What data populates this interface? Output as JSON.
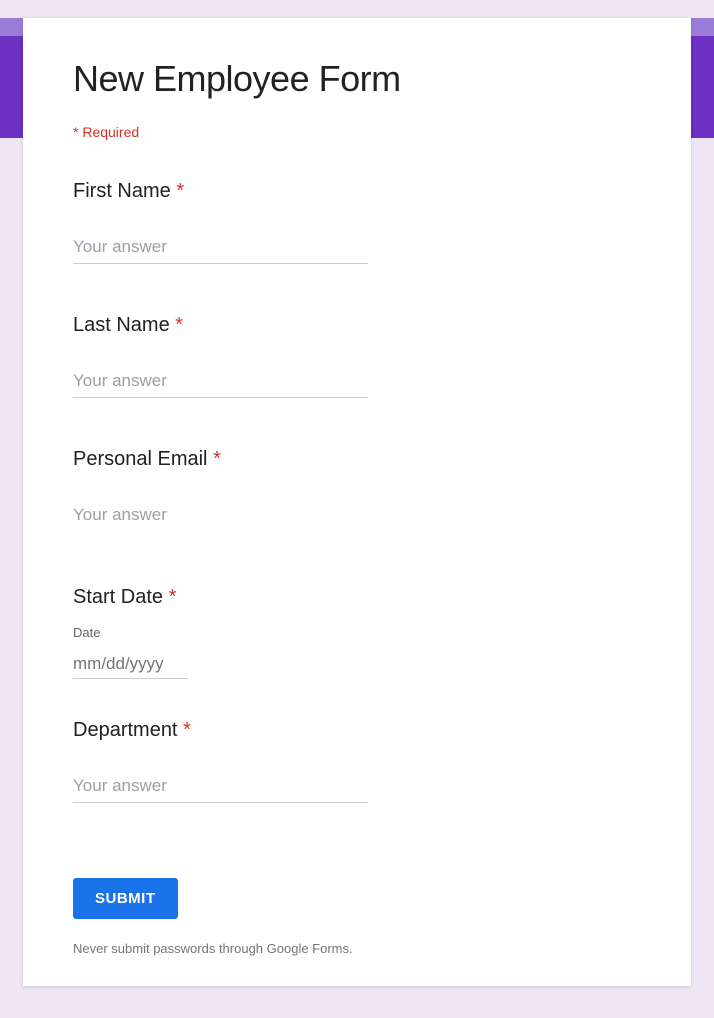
{
  "form": {
    "title": "New Employee Form",
    "required_note": "* Required",
    "submit_label": "SUBMIT",
    "disclaimer": "Never submit passwords through Google Forms."
  },
  "fields": {
    "first_name": {
      "label": "First Name ",
      "placeholder": "Your answer"
    },
    "last_name": {
      "label": "Last Name ",
      "placeholder": "Your answer"
    },
    "personal_email": {
      "label": "Personal Email ",
      "placeholder": "Your answer"
    },
    "start_date": {
      "label": "Start Date ",
      "sublabel": "Date",
      "placeholder": "mm/dd/yyyy"
    },
    "department": {
      "label": "Department ",
      "placeholder": "Your answer"
    }
  },
  "asterisk": "*"
}
